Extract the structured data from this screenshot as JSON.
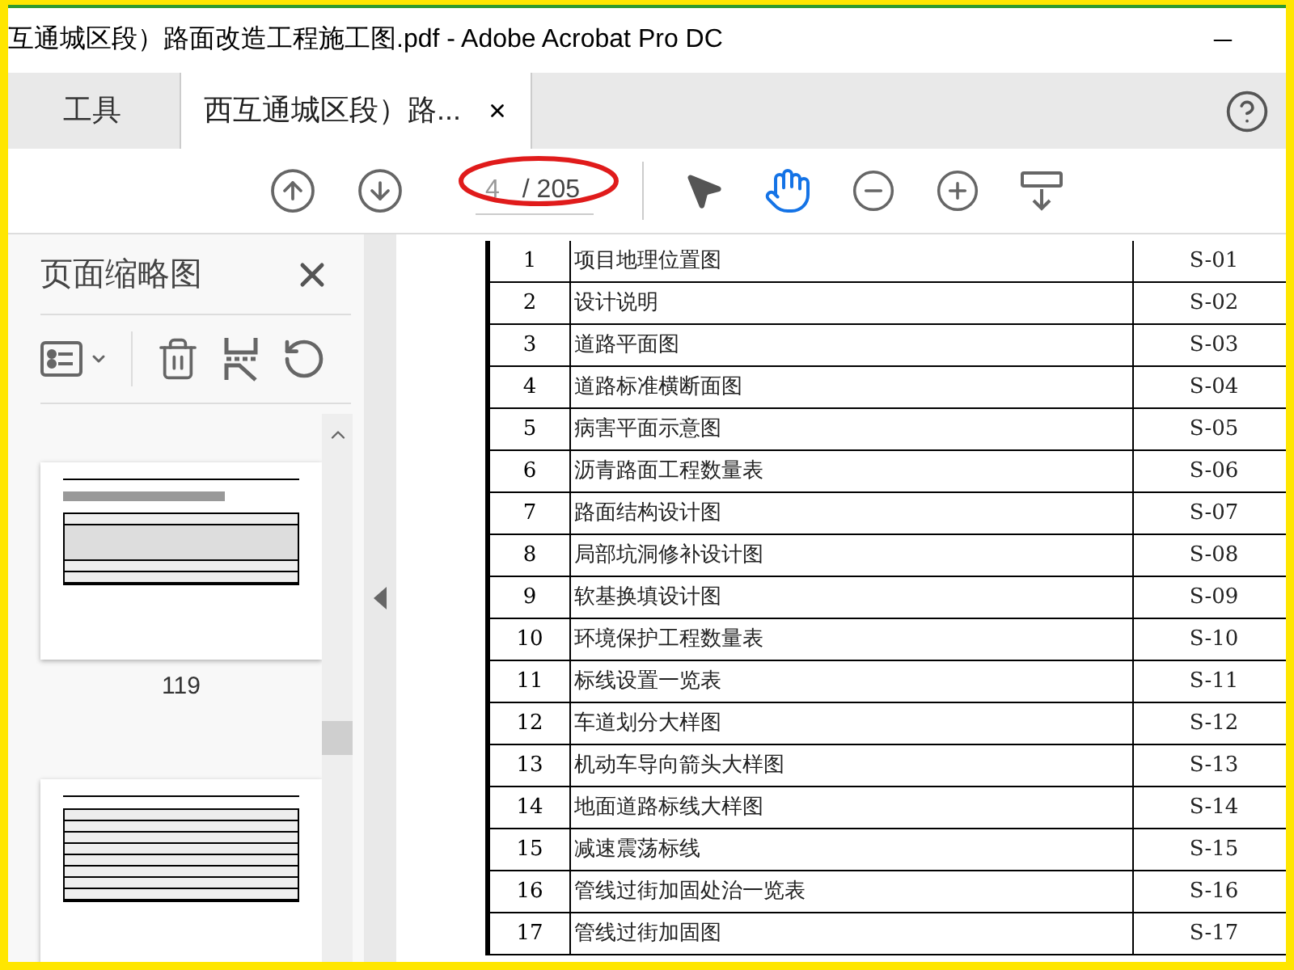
{
  "window": {
    "title": "互通城区段）路面改造工程施工图.pdf - Adobe Acrobat Pro DC"
  },
  "tabs": [
    {
      "label": "工具",
      "selected": false
    },
    {
      "label": "西互通城区段）路...",
      "selected": true
    }
  ],
  "toolbar": {
    "page_value": "4",
    "page_total": "/ 205",
    "hand_tool_selected": true
  },
  "sidebar": {
    "title": "页面缩略图",
    "thumbnails": [
      {
        "label": "119",
        "kind": "photos"
      },
      {
        "kind": "table"
      }
    ]
  },
  "table": {
    "rows": [
      {
        "num": "1",
        "name": "项目地理位置图",
        "code": "S-01"
      },
      {
        "num": "2",
        "name": "设计说明",
        "code": "S-02"
      },
      {
        "num": "3",
        "name": "道路平面图",
        "code": "S-03"
      },
      {
        "num": "4",
        "name": "道路标准横断面图",
        "code": "S-04"
      },
      {
        "num": "5",
        "name": "病害平面示意图",
        "code": "S-05"
      },
      {
        "num": "6",
        "name": "沥青路面工程数量表",
        "code": "S-06"
      },
      {
        "num": "7",
        "name": "路面结构设计图",
        "code": "S-07"
      },
      {
        "num": "8",
        "name": "局部坑洞修补设计图",
        "code": "S-08"
      },
      {
        "num": "9",
        "name": "软基换填设计图",
        "code": "S-09"
      },
      {
        "num": "10",
        "name": "环境保护工程数量表",
        "code": "S-10"
      },
      {
        "num": "11",
        "name": "标线设置一览表",
        "code": "S-11"
      },
      {
        "num": "12",
        "name": "车道划分大样图",
        "code": "S-12"
      },
      {
        "num": "13",
        "name": "机动车导向箭头大样图",
        "code": "S-13"
      },
      {
        "num": "14",
        "name": "地面道路标线大样图",
        "code": "S-14"
      },
      {
        "num": "15",
        "name": "减速震荡标线",
        "code": "S-15"
      },
      {
        "num": "16",
        "name": "管线过街加固处治一览表",
        "code": "S-16"
      },
      {
        "num": "17",
        "name": "管线过街加固图",
        "code": "S-17"
      }
    ]
  }
}
